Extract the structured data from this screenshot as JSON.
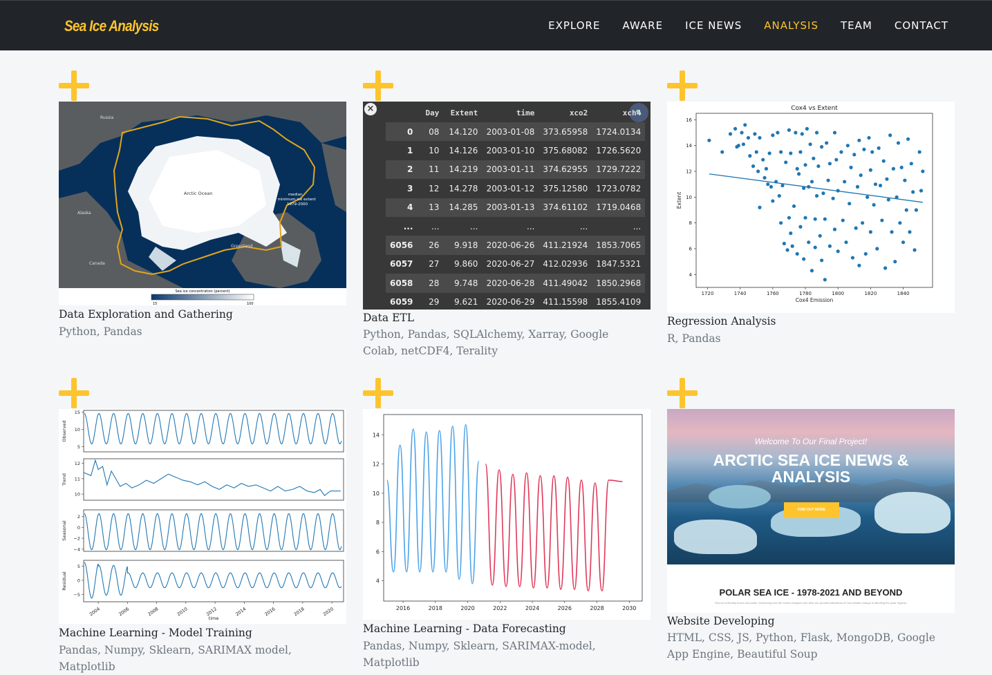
{
  "brand": "Sea Ice Analysis",
  "nav": [
    "EXPLORE",
    "AWARE",
    "ICE NEWS",
    "ANALYSIS",
    "TEAM",
    "CONTACT"
  ],
  "active_nav": "ANALYSIS",
  "colors": {
    "accent": "#fdc42d",
    "navbar": "#212529",
    "page_bg": "#f4f6f8",
    "muted": "#6c757d"
  },
  "cards": [
    {
      "title": "Data Exploration and Gathering",
      "tags": "Python, Pandas"
    },
    {
      "title": "Data ETL",
      "tags": "Python, Pandas, SQLAlchemy, Xarray, Google Colab, netCDF4, Terality"
    },
    {
      "title": "Regression Analysis",
      "tags": "R, Pandas"
    },
    {
      "title": "Machine Learning - Model Training",
      "tags": "Pandas, Numpy, Sklearn, SARIMAX model, Matplotlib"
    },
    {
      "title": "Machine Learning - Data Forecasting",
      "tags": "Pandas, Numpy, Sklearn, SARIMAX-model, Matplotlib"
    },
    {
      "title": "Website Developing",
      "tags": "HTML, CSS, JS, Python, Flask, MongoDB, Google App Engine, Beautiful Soup"
    }
  ],
  "map": {
    "labels": {
      "russia": "Russia",
      "arctic": "Arctic Ocean",
      "alaska": "Alaska",
      "canada": "Canada",
      "greenland": "Greenland",
      "median": "median\nminimum ice extent\n1979-2000"
    },
    "colorbar_title": "Sea ice concentration (percent)",
    "colorbar_min": "15",
    "colorbar_max": "100"
  },
  "etl_table": {
    "columns": [
      "",
      "Day",
      "Extent",
      "time",
      "xco2",
      "xch4"
    ],
    "rows": [
      [
        "0",
        "08",
        "14.120",
        "2003-01-08",
        "373.65958",
        "1724.0134"
      ],
      [
        "1",
        "10",
        "14.126",
        "2003-01-10",
        "375.68082",
        "1726.5620"
      ],
      [
        "2",
        "11",
        "14.219",
        "2003-01-11",
        "374.62955",
        "1729.7222"
      ],
      [
        "3",
        "12",
        "14.278",
        "2003-01-12",
        "375.12580",
        "1723.0782"
      ],
      [
        "4",
        "13",
        "14.285",
        "2003-01-13",
        "374.61102",
        "1719.0468"
      ],
      [
        "...",
        "...",
        "...",
        "...",
        "...",
        "..."
      ],
      [
        "6056",
        "26",
        "9.918",
        "2020-06-26",
        "411.21924",
        "1853.7065"
      ],
      [
        "6057",
        "27",
        "9.860",
        "2020-06-27",
        "412.02936",
        "1847.5321"
      ],
      [
        "6058",
        "28",
        "9.748",
        "2020-06-28",
        "411.49042",
        "1850.2968"
      ],
      [
        "6059",
        "29",
        "9.621",
        "2020-06-29",
        "411.15598",
        "1855.4109"
      ]
    ]
  },
  "hero": {
    "welcome": "Welcome To Our Final Project!",
    "heading": "ARCTIC SEA ICE NEWS & ANALYSIS",
    "button": "FIND OUT MORE",
    "subheading": "POLAR SEA ICE - 1978-2021 AND BEYOND",
    "small_text": "Sea ice is literally frozen sea water. Monitoring how the extent changes over time can provide indications of how climate change is affecting the polar regions."
  },
  "chart_data": [
    {
      "type": "scatter",
      "title": "Cox4 vs Extent",
      "xlabel": "Cox4 Emission",
      "ylabel": "Extent",
      "xlim": [
        1713,
        1858
      ],
      "ylim": [
        3,
        16.5
      ],
      "xticks": [
        1720,
        1740,
        1760,
        1780,
        1800,
        1820,
        1840
      ],
      "yticks": [
        4,
        6,
        8,
        10,
        12,
        14,
        16
      ],
      "points": [
        [
          1721,
          14.4
        ],
        [
          1729,
          13.5
        ],
        [
          1734,
          14.9
        ],
        [
          1737,
          15.3
        ],
        [
          1738,
          13.9
        ],
        [
          1739,
          14.0
        ],
        [
          1741,
          15.0
        ],
        [
          1742,
          14.1
        ],
        [
          1743,
          15.6
        ],
        [
          1745,
          14.6
        ],
        [
          1746,
          13.2
        ],
        [
          1748,
          12.4
        ],
        [
          1749,
          14.9
        ],
        [
          1750,
          13.5
        ],
        [
          1751,
          12.0
        ],
        [
          1752,
          14.6
        ],
        [
          1752,
          9.2
        ],
        [
          1754,
          12.9
        ],
        [
          1755,
          11.5
        ],
        [
          1756,
          12.2
        ],
        [
          1757,
          11.0
        ],
        [
          1758,
          13.4
        ],
        [
          1759,
          10.8
        ],
        [
          1760,
          14.8
        ],
        [
          1760,
          9.7
        ],
        [
          1762,
          11.2
        ],
        [
          1763,
          15.0
        ],
        [
          1764,
          10.1
        ],
        [
          1765,
          13.5
        ],
        [
          1765,
          8.0
        ],
        [
          1766,
          10.9
        ],
        [
          1767,
          6.4
        ],
        [
          1768,
          12.7
        ],
        [
          1769,
          5.9
        ],
        [
          1770,
          15.2
        ],
        [
          1770,
          8.4
        ],
        [
          1771,
          13.4
        ],
        [
          1771,
          7.2
        ],
        [
          1772,
          6.2
        ],
        [
          1773,
          9.3
        ],
        [
          1774,
          15.0
        ],
        [
          1775,
          12.2
        ],
        [
          1775,
          5.6
        ],
        [
          1776,
          11.8
        ],
        [
          1777,
          13.5
        ],
        [
          1777,
          7.7
        ],
        [
          1778,
          14.9
        ],
        [
          1779,
          10.7
        ],
        [
          1779,
          5.2
        ],
        [
          1780,
          12.5
        ],
        [
          1780,
          8.4
        ],
        [
          1781,
          15.3
        ],
        [
          1782,
          10.8
        ],
        [
          1782,
          6.5
        ],
        [
          1783,
          14.1
        ],
        [
          1784,
          11.2
        ],
        [
          1784,
          4.3
        ],
        [
          1785,
          13.0
        ],
        [
          1786,
          8.3
        ],
        [
          1786,
          6.1
        ],
        [
          1787,
          15.0
        ],
        [
          1787,
          10.1
        ],
        [
          1788,
          12.4
        ],
        [
          1789,
          7.0
        ],
        [
          1790,
          13.9
        ],
        [
          1790,
          5.1
        ],
        [
          1791,
          10.3
        ],
        [
          1792,
          8.3
        ],
        [
          1792,
          3.6
        ],
        [
          1793,
          14.2
        ],
        [
          1794,
          11.3
        ],
        [
          1795,
          12.6
        ],
        [
          1795,
          6.2
        ],
        [
          1797,
          9.9
        ],
        [
          1798,
          15.0
        ],
        [
          1798,
          7.5
        ],
        [
          1799,
          12.9
        ],
        [
          1800,
          10.5
        ],
        [
          1800,
          5.8
        ],
        [
          1802,
          13.5
        ],
        [
          1803,
          8.2
        ],
        [
          1804,
          11.2
        ],
        [
          1805,
          6.5
        ],
        [
          1806,
          14.0
        ],
        [
          1807,
          9.5
        ],
        [
          1808,
          12.3
        ],
        [
          1809,
          5.3
        ],
        [
          1810,
          13.3
        ],
        [
          1811,
          7.6
        ],
        [
          1812,
          10.8
        ],
        [
          1813,
          14.4
        ],
        [
          1813,
          4.7
        ],
        [
          1814,
          11.7
        ],
        [
          1815,
          8.0
        ],
        [
          1816,
          13.7
        ],
        [
          1817,
          5.6
        ],
        [
          1818,
          10.0
        ],
        [
          1819,
          14.6
        ],
        [
          1820,
          12.1
        ],
        [
          1820,
          7.3
        ],
        [
          1821,
          13.5
        ],
        [
          1822,
          9.4
        ],
        [
          1823,
          11.0
        ],
        [
          1824,
          6.0
        ],
        [
          1825,
          13.8
        ],
        [
          1826,
          10.9
        ],
        [
          1827,
          8.2
        ],
        [
          1828,
          12.8
        ],
        [
          1829,
          4.5
        ],
        [
          1830,
          11.4
        ],
        [
          1831,
          9.8
        ],
        [
          1832,
          14.8
        ],
        [
          1833,
          7.3
        ],
        [
          1834,
          12.2
        ],
        [
          1835,
          5.0
        ],
        [
          1836,
          10.0
        ],
        [
          1837,
          14.2
        ],
        [
          1838,
          8.0
        ],
        [
          1839,
          12.3
        ],
        [
          1840,
          6.5
        ],
        [
          1841,
          11.3
        ],
        [
          1842,
          9.0
        ],
        [
          1843,
          14.5
        ],
        [
          1844,
          7.3
        ],
        [
          1845,
          12.6
        ],
        [
          1846,
          10.4
        ],
        [
          1847,
          5.9
        ],
        [
          1848,
          9.0
        ],
        [
          1850,
          13.5
        ],
        [
          1851,
          10.5
        ],
        [
          1852,
          12.0
        ]
      ],
      "trendline": [
        [
          1721,
          11.8
        ],
        [
          1852,
          9.6
        ]
      ]
    },
    {
      "type": "line",
      "title": "",
      "panels": [
        {
          "ylabel": "Observed",
          "yticks": [
            5,
            10,
            15
          ],
          "ylim": [
            3.5,
            15.5
          ]
        },
        {
          "ylabel": "Trend",
          "yticks": [
            10,
            11,
            12
          ],
          "ylim": [
            9.6,
            12.3
          ]
        },
        {
          "ylabel": "Seasonal",
          "yticks": [
            -4,
            -2,
            0,
            2
          ],
          "ylim": [
            -4.4,
            3.2
          ]
        },
        {
          "ylabel": "Residual",
          "yticks": [
            -5,
            0,
            5
          ],
          "ylim": [
            -7.5,
            7
          ]
        }
      ],
      "xlabel": "time",
      "xticks": [
        "2004",
        "2006",
        "2008",
        "2010",
        "2012",
        "2014",
        "2016",
        "2018",
        "2020"
      ],
      "xlim": [
        2003,
        2020.8
      ],
      "trend_values": [
        [
          2003.0,
          11.4
        ],
        [
          2003.5,
          11.2
        ],
        [
          2003.8,
          12.2
        ],
        [
          2004.0,
          11.6
        ],
        [
          2004.3,
          11.8
        ],
        [
          2004.6,
          10.6
        ],
        [
          2004.9,
          11.5
        ],
        [
          2005.2,
          11.0
        ],
        [
          2005.5,
          10.5
        ],
        [
          2005.9,
          10.7
        ],
        [
          2006.3,
          10.4
        ],
        [
          2006.8,
          10.6
        ],
        [
          2007.3,
          10.9
        ],
        [
          2007.8,
          10.7
        ],
        [
          2008.3,
          11.0
        ],
        [
          2008.8,
          11.3
        ],
        [
          2009.3,
          11.1
        ],
        [
          2009.8,
          10.9
        ],
        [
          2010.3,
          10.8
        ],
        [
          2010.8,
          10.6
        ],
        [
          2011.3,
          10.8
        ],
        [
          2011.8,
          10.5
        ],
        [
          2012.3,
          10.3
        ],
        [
          2012.8,
          10.6
        ],
        [
          2013.3,
          10.4
        ],
        [
          2013.8,
          10.7
        ],
        [
          2014.3,
          10.5
        ],
        [
          2014.8,
          10.6
        ],
        [
          2015.3,
          10.4
        ],
        [
          2015.8,
          10.2
        ],
        [
          2016.3,
          10.5
        ],
        [
          2016.8,
          10.2
        ],
        [
          2017.3,
          10.3
        ],
        [
          2017.8,
          10.5
        ],
        [
          2018.3,
          10.2
        ],
        [
          2018.8,
          10.1
        ],
        [
          2019.2,
          10.3
        ],
        [
          2019.5,
          9.9
        ],
        [
          2019.9,
          10.2
        ],
        [
          2020.4,
          10.2
        ],
        [
          2020.6,
          10.2
        ]
      ]
    },
    {
      "type": "line",
      "title": "",
      "xlim": [
        2014.8,
        2030.8
      ],
      "ylim": [
        2.6,
        15.4
      ],
      "xticks": [
        2016,
        2018,
        2020,
        2022,
        2024,
        2026,
        2028,
        2030
      ],
      "yticks": [
        4,
        6,
        8,
        10,
        12,
        14
      ],
      "series": [
        {
          "color": "#4da3e8",
          "x_range": [
            2015.0,
            2021.1
          ],
          "peaks": [
            10.9,
            13.3,
            14.4,
            14.2,
            14.3,
            14.6,
            14.7,
            12.2
          ],
          "troughs": [
            4.6,
            4.6,
            4.6,
            4.6,
            4.6,
            4.1,
            3.8
          ]
        },
        {
          "color": "#e0395a",
          "x_range": [
            2021.1,
            2030.0
          ],
          "peaks": [
            12.0,
            11.6,
            11.3,
            11.4,
            11.2,
            11.2,
            11.1,
            10.9,
            10.7,
            10.9,
            10.8
          ],
          "troughs": [
            3.7,
            3.6,
            3.6,
            3.5,
            3.5,
            3.4,
            3.4,
            3.3,
            3.3
          ]
        }
      ]
    }
  ]
}
